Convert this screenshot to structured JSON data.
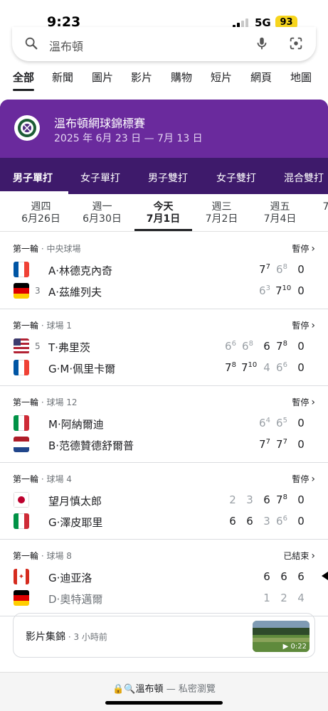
{
  "status_bar": {
    "time": "9:23",
    "network": "5G",
    "battery": "93"
  },
  "search": {
    "query": "溫布頓"
  },
  "tabs": [
    "全部",
    "新聞",
    "圖片",
    "影片",
    "購物",
    "短片",
    "網頁",
    "地圖"
  ],
  "event": {
    "title": "溫布頓網球錦標賽",
    "dates": "2025 年 6月 23 日 — 7月 13 日",
    "categories": [
      "男子單打",
      "女子單打",
      "男子雙打",
      "女子雙打",
      "混合雙打"
    ]
  },
  "days": [
    {
      "dow": "週四",
      "date": "6月26日"
    },
    {
      "dow": "週一",
      "date": "6月30日"
    },
    {
      "dow": "今天",
      "date": "7月1日"
    },
    {
      "dow": "週三",
      "date": "7月2日"
    },
    {
      "dow": "週五",
      "date": "7月4日"
    },
    {
      "dow": "",
      "date": "7"
    }
  ],
  "matches": [
    {
      "round": "第一輪",
      "court": "中央球場",
      "status": "暫停",
      "players": [
        {
          "country": "France",
          "seed": "",
          "name": "A·林德克內奇",
          "scores": [
            "7",
            "6",
            "0"
          ],
          "tb": [
            "7",
            "8",
            ""
          ]
        },
        {
          "country": "Germany",
          "seed": "3",
          "name": "A·茲維列夫",
          "scores": [
            "6",
            "7",
            "0"
          ],
          "tb": [
            "3",
            "10",
            ""
          ]
        }
      ]
    },
    {
      "round": "第一輪",
      "court": "球場 1",
      "status": "暫停",
      "players": [
        {
          "country": "USA",
          "seed": "5",
          "name": "T·弗里茨",
          "scores": [
            "6",
            "6",
            "6",
            "7",
            "0"
          ],
          "tb": [
            "6",
            "8",
            "",
            "8",
            ""
          ]
        },
        {
          "country": "France",
          "seed": "",
          "name": "G·M·佩里卡爾",
          "scores": [
            "7",
            "7",
            "4",
            "6",
            "0"
          ],
          "tb": [
            "8",
            "10",
            "",
            "6",
            ""
          ]
        }
      ]
    },
    {
      "round": "第一輪",
      "court": "球場 12",
      "status": "暫停",
      "players": [
        {
          "country": "Italy",
          "seed": "",
          "name": "M·阿納爾迪",
          "scores": [
            "6",
            "6",
            "0"
          ],
          "tb": [
            "4",
            "5",
            ""
          ]
        },
        {
          "country": "Netherlands",
          "seed": "",
          "name": "B·范德贊德舒爾普",
          "scores": [
            "7",
            "7",
            "0"
          ],
          "tb": [
            "7",
            "7",
            ""
          ]
        }
      ]
    },
    {
      "round": "第一輪",
      "court": "球場 4",
      "status": "暫停",
      "players": [
        {
          "country": "Japan",
          "seed": "",
          "name": "望月慎太郎",
          "scores": [
            "2",
            "3",
            "6",
            "7",
            "0"
          ],
          "tb": [
            "",
            "",
            "",
            "8",
            ""
          ]
        },
        {
          "country": "Italy",
          "seed": "",
          "name": "G·澤皮耶里",
          "scores": [
            "6",
            "6",
            "3",
            "6",
            "0"
          ],
          "tb": [
            "",
            "",
            "",
            "6",
            ""
          ]
        }
      ]
    },
    {
      "round": "第一輪",
      "court": "球場 8",
      "status": "已結束",
      "players": [
        {
          "country": "Canada",
          "seed": "",
          "name": "G·迪亚洛",
          "scores": [
            "6",
            "6",
            "6"
          ],
          "tb": [
            "",
            "",
            ""
          ]
        },
        {
          "country": "Germany",
          "seed": "",
          "name": "D·奧特邁爾",
          "scores": [
            "1",
            "2",
            "4"
          ],
          "tb": [
            "",
            "",
            ""
          ]
        }
      ]
    }
  ],
  "video": {
    "label": "影片集錦",
    "ago": "3 小時前",
    "duration": "0:22"
  },
  "bottom": {
    "query": "溫布頓",
    "private": "私密瀏覽"
  }
}
